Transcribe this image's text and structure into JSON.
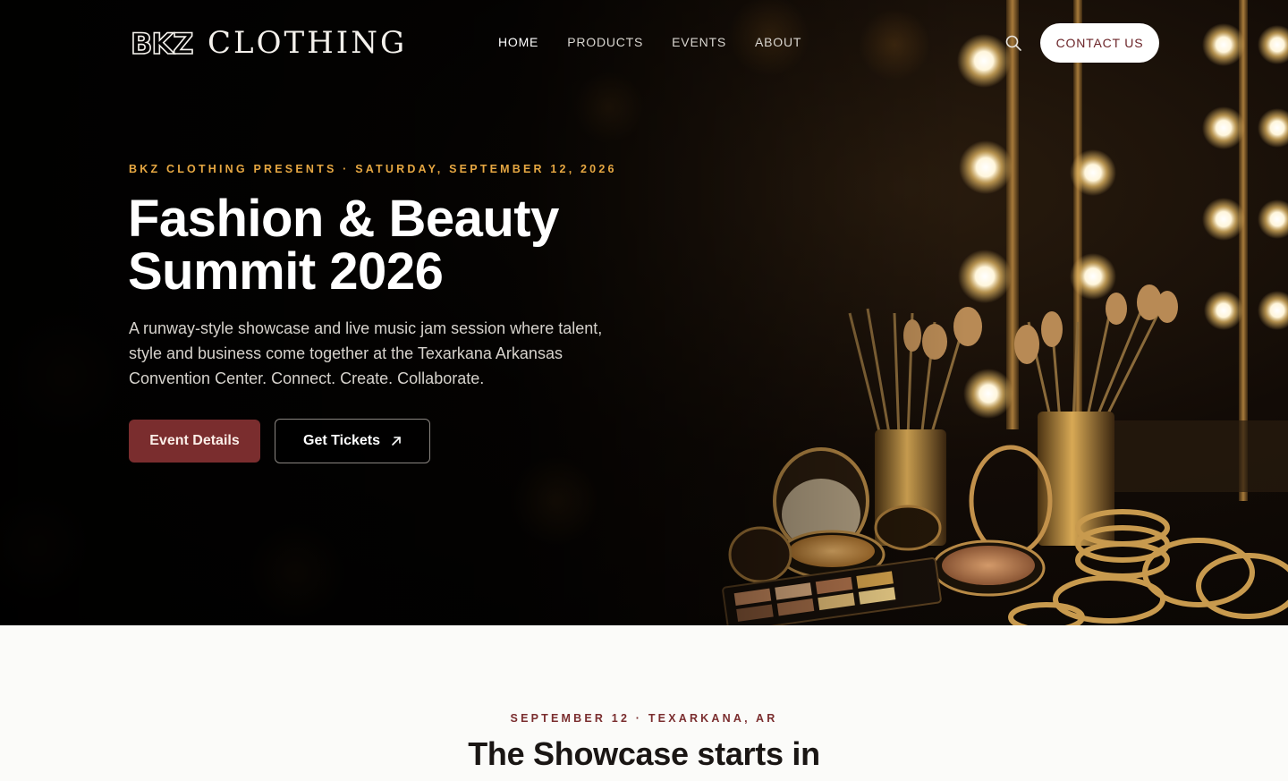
{
  "brand": {
    "mark": "BKZ",
    "word": "CLOTHING"
  },
  "nav": {
    "items": [
      {
        "label": "HOME"
      },
      {
        "label": "PRODUCTS"
      },
      {
        "label": "EVENTS"
      },
      {
        "label": "ABOUT"
      }
    ],
    "search_icon": "search-icon",
    "contact_label": "CONTACT US"
  },
  "hero": {
    "eyebrow": "BKZ CLOTHING PRESENTS · SATURDAY, SEPTEMBER 12, 2026",
    "title_line1": "Fashion & Beauty",
    "title_line2": "Summit 2026",
    "description": "A runway-style showcase and live music jam session where talent, style and business come together at the Texarkana Arkansas Convention Center. Connect. Create. Collaborate.",
    "primary_button": "Event Details",
    "secondary_button": "Get Tickets",
    "secondary_icon": "arrow-up-right-icon"
  },
  "countdown": {
    "eyebrow": "SEPTEMBER 12 · TEXARKANA, AR",
    "title": "The Showcase starts in"
  },
  "colors": {
    "accent_gold": "#e6a742",
    "brand_maroon": "#7a2d2e",
    "contact_text": "#6b2428",
    "hero_bg": "#060403"
  }
}
